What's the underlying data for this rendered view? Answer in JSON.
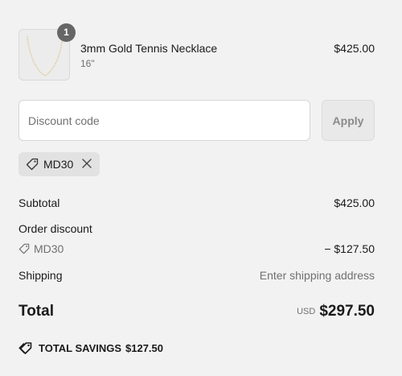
{
  "line_item": {
    "quantity": "1",
    "name": "3mm Gold Tennis Necklace",
    "variant": "16\"",
    "price": "$425.00",
    "image_icon": "necklace-image"
  },
  "discount": {
    "placeholder": "Discount code",
    "value": "",
    "apply_label": "Apply",
    "applied_code": "MD30",
    "remove_icon": "close-icon"
  },
  "summary": {
    "subtotal_label": "Subtotal",
    "subtotal_value": "$425.00",
    "order_discount_label": "Order discount",
    "discount_code": "MD30",
    "discount_value": "− $127.50",
    "shipping_label": "Shipping",
    "shipping_value": "Enter shipping address",
    "total_label": "Total",
    "currency": "USD",
    "total_value": "$297.50",
    "savings_label": "TOTAL SAVINGS",
    "savings_value": "$127.50"
  },
  "colors": {
    "background": "#f2f2f2",
    "badge": "#666666",
    "muted_text": "#707070"
  }
}
